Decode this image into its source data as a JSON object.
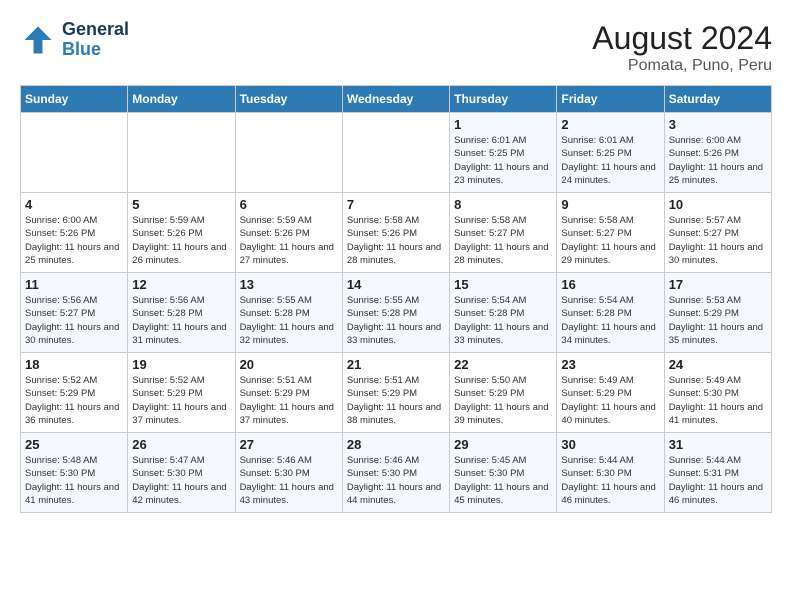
{
  "header": {
    "logo_line1": "General",
    "logo_line2": "Blue",
    "title": "August 2024",
    "subtitle": "Pomata, Puno, Peru"
  },
  "weekdays": [
    "Sunday",
    "Monday",
    "Tuesday",
    "Wednesday",
    "Thursday",
    "Friday",
    "Saturday"
  ],
  "weeks": [
    [
      {
        "day": "",
        "info": ""
      },
      {
        "day": "",
        "info": ""
      },
      {
        "day": "",
        "info": ""
      },
      {
        "day": "",
        "info": ""
      },
      {
        "day": "1",
        "info": "Sunrise: 6:01 AM\nSunset: 5:25 PM\nDaylight: 11 hours and 23 minutes."
      },
      {
        "day": "2",
        "info": "Sunrise: 6:01 AM\nSunset: 5:25 PM\nDaylight: 11 hours and 24 minutes."
      },
      {
        "day": "3",
        "info": "Sunrise: 6:00 AM\nSunset: 5:26 PM\nDaylight: 11 hours and 25 minutes."
      }
    ],
    [
      {
        "day": "4",
        "info": "Sunrise: 6:00 AM\nSunset: 5:26 PM\nDaylight: 11 hours and 25 minutes."
      },
      {
        "day": "5",
        "info": "Sunrise: 5:59 AM\nSunset: 5:26 PM\nDaylight: 11 hours and 26 minutes."
      },
      {
        "day": "6",
        "info": "Sunrise: 5:59 AM\nSunset: 5:26 PM\nDaylight: 11 hours and 27 minutes."
      },
      {
        "day": "7",
        "info": "Sunrise: 5:58 AM\nSunset: 5:26 PM\nDaylight: 11 hours and 28 minutes."
      },
      {
        "day": "8",
        "info": "Sunrise: 5:58 AM\nSunset: 5:27 PM\nDaylight: 11 hours and 28 minutes."
      },
      {
        "day": "9",
        "info": "Sunrise: 5:58 AM\nSunset: 5:27 PM\nDaylight: 11 hours and 29 minutes."
      },
      {
        "day": "10",
        "info": "Sunrise: 5:57 AM\nSunset: 5:27 PM\nDaylight: 11 hours and 30 minutes."
      }
    ],
    [
      {
        "day": "11",
        "info": "Sunrise: 5:56 AM\nSunset: 5:27 PM\nDaylight: 11 hours and 30 minutes."
      },
      {
        "day": "12",
        "info": "Sunrise: 5:56 AM\nSunset: 5:28 PM\nDaylight: 11 hours and 31 minutes."
      },
      {
        "day": "13",
        "info": "Sunrise: 5:55 AM\nSunset: 5:28 PM\nDaylight: 11 hours and 32 minutes."
      },
      {
        "day": "14",
        "info": "Sunrise: 5:55 AM\nSunset: 5:28 PM\nDaylight: 11 hours and 33 minutes."
      },
      {
        "day": "15",
        "info": "Sunrise: 5:54 AM\nSunset: 5:28 PM\nDaylight: 11 hours and 33 minutes."
      },
      {
        "day": "16",
        "info": "Sunrise: 5:54 AM\nSunset: 5:28 PM\nDaylight: 11 hours and 34 minutes."
      },
      {
        "day": "17",
        "info": "Sunrise: 5:53 AM\nSunset: 5:29 PM\nDaylight: 11 hours and 35 minutes."
      }
    ],
    [
      {
        "day": "18",
        "info": "Sunrise: 5:52 AM\nSunset: 5:29 PM\nDaylight: 11 hours and 36 minutes."
      },
      {
        "day": "19",
        "info": "Sunrise: 5:52 AM\nSunset: 5:29 PM\nDaylight: 11 hours and 37 minutes."
      },
      {
        "day": "20",
        "info": "Sunrise: 5:51 AM\nSunset: 5:29 PM\nDaylight: 11 hours and 37 minutes."
      },
      {
        "day": "21",
        "info": "Sunrise: 5:51 AM\nSunset: 5:29 PM\nDaylight: 11 hours and 38 minutes."
      },
      {
        "day": "22",
        "info": "Sunrise: 5:50 AM\nSunset: 5:29 PM\nDaylight: 11 hours and 39 minutes."
      },
      {
        "day": "23",
        "info": "Sunrise: 5:49 AM\nSunset: 5:29 PM\nDaylight: 11 hours and 40 minutes."
      },
      {
        "day": "24",
        "info": "Sunrise: 5:49 AM\nSunset: 5:30 PM\nDaylight: 11 hours and 41 minutes."
      }
    ],
    [
      {
        "day": "25",
        "info": "Sunrise: 5:48 AM\nSunset: 5:30 PM\nDaylight: 11 hours and 41 minutes."
      },
      {
        "day": "26",
        "info": "Sunrise: 5:47 AM\nSunset: 5:30 PM\nDaylight: 11 hours and 42 minutes."
      },
      {
        "day": "27",
        "info": "Sunrise: 5:46 AM\nSunset: 5:30 PM\nDaylight: 11 hours and 43 minutes."
      },
      {
        "day": "28",
        "info": "Sunrise: 5:46 AM\nSunset: 5:30 PM\nDaylight: 11 hours and 44 minutes."
      },
      {
        "day": "29",
        "info": "Sunrise: 5:45 AM\nSunset: 5:30 PM\nDaylight: 11 hours and 45 minutes."
      },
      {
        "day": "30",
        "info": "Sunrise: 5:44 AM\nSunset: 5:30 PM\nDaylight: 11 hours and 46 minutes."
      },
      {
        "day": "31",
        "info": "Sunrise: 5:44 AM\nSunset: 5:31 PM\nDaylight: 11 hours and 46 minutes."
      }
    ]
  ]
}
